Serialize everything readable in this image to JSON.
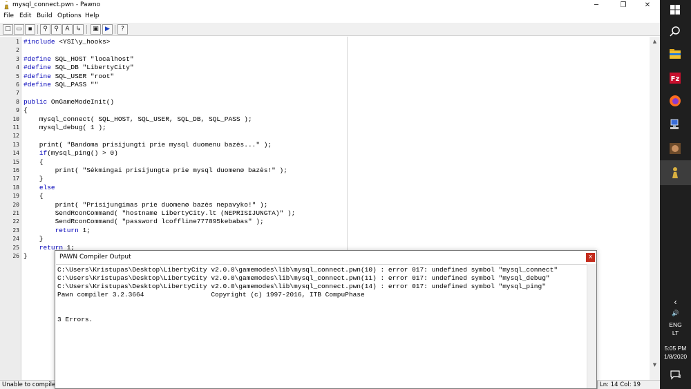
{
  "window": {
    "title": "mysql_connect.pwn - Pawno",
    "min_glyph": "─",
    "max_glyph": "❐",
    "close_glyph": "✕"
  },
  "menu": [
    "File",
    "Edit",
    "Build",
    "Options",
    "Help"
  ],
  "toolbar": {
    "buttons": [
      {
        "name": "new-file",
        "glyph": "□"
      },
      {
        "name": "open-file",
        "glyph": "▭"
      },
      {
        "name": "save-file",
        "glyph": "▪"
      },
      {
        "name": "find",
        "glyph": "⚲"
      },
      {
        "name": "find-next",
        "glyph": "⚲"
      },
      {
        "name": "replace",
        "glyph": "A"
      },
      {
        "name": "goto",
        "glyph": "↳"
      },
      {
        "name": "compile",
        "glyph": "▣"
      },
      {
        "name": "run",
        "glyph": "▶"
      },
      {
        "name": "help",
        "glyph": "?"
      }
    ]
  },
  "editor": {
    "lines": [
      "#include <YSI\\y_hooks>",
      "",
      "#define SQL_HOST \"localhost\"",
      "#define SQL_DB \"LibertyCity\"",
      "#define SQL_USER \"root\"",
      "#define SQL_PASS \"\"",
      "",
      "public OnGameModeInit()",
      "{",
      "    mysql_connect( SQL_HOST, SQL_USER, SQL_DB, SQL_PASS );",
      "    mysql_debug( 1 );",
      "",
      "    print( \"Bandoma prisijungti prie mysql duomenu bazės...\" );",
      "    if(mysql_ping() > 0)",
      "    {",
      "        print( \"Sėkmingai prisijungta prie mysql duomenø bazės!\" );",
      "    }",
      "    else",
      "    {",
      "        print( \"Prisijungimas prie duomenø bazės nepavyko!\" );",
      "        SendRconCommand( \"hostname LibertyCity.lt (NEPRISIJUNGTA)\" );",
      "        SendRconCommand( \"password lcoffline777895kebabas\" );",
      "        return 1;",
      "    }",
      "    return 1;",
      "}"
    ]
  },
  "status": {
    "message": "Unable to compile 'mysql_connect.pwn'",
    "position": "Ln: 14  Col: 19"
  },
  "compiler_dialog": {
    "title": "PAWN Compiler Output",
    "close_glyph": "x",
    "lines": [
      "C:\\Users\\Kristupas\\Desktop\\LibertyCity v2.0.0\\gamemodes\\lib\\mysql_connect.pwn(10) : error 017: undefined symbol \"mysql_connect\"",
      "C:\\Users\\Kristupas\\Desktop\\LibertyCity v2.0.0\\gamemodes\\lib\\mysql_connect.pwn(11) : error 017: undefined symbol \"mysql_debug\"",
      "C:\\Users\\Kristupas\\Desktop\\LibertyCity v2.0.0\\gamemodes\\lib\\mysql_connect.pwn(14) : error 017: undefined symbol \"mysql_ping\"",
      "Pawn compiler 3.2.3664                 Copyright (c) 1997-2016, ITB CompuPhase",
      "",
      "",
      "3 Errors."
    ]
  },
  "taskbar": {
    "chevron": "‹",
    "volume_glyph": "🔊",
    "language": "ENG",
    "region": "LT",
    "time": "5:05 PM",
    "date": "1/8/2020",
    "notification_count": "3"
  }
}
